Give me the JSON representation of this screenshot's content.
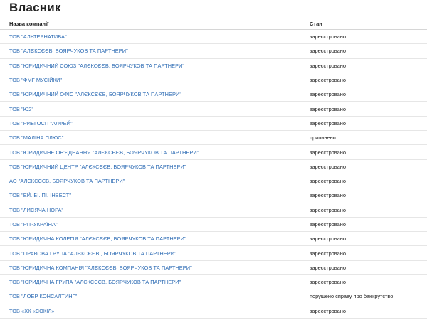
{
  "page": {
    "title": "Власник"
  },
  "table": {
    "headers": {
      "name": "Назва компанії",
      "status": "Стан"
    },
    "rows": [
      {
        "name": "ТОВ \"АЛЬТЕРНАТИВА\"",
        "status": "зареєстровано"
      },
      {
        "name": "ТОВ \"АЛЄКСЄЄВ, БОЯРЧУКОВ ТА ПАРТНЕРИ\"",
        "status": "зареєстровано"
      },
      {
        "name": "ТОВ \"ЮРИДИЧНИЙ СОЮЗ \"АЛЄКСЄЄВ, БОЯРЧУКОВ ТА ПАРТНЕРИ\"",
        "status": "зареєстровано"
      },
      {
        "name": "ТОВ \"ФМГ МУСІЙКИ\"",
        "status": "зареєстровано"
      },
      {
        "name": "ТОВ \"ЮРИДИЧНИЙ ОФІС \"АЛЄКСЄЄВ, БОЯРЧУКОВ ТА ПАРТНЕРИ\"",
        "status": "зареєстровано"
      },
      {
        "name": "ТОВ \"Ю2\"",
        "status": "зареєстровано"
      },
      {
        "name": "ТОВ \"РИБГОСП \"АЛФЕЙ\"",
        "status": "зареєстровано"
      },
      {
        "name": "ТОВ \"МАЛІНА ПЛЮС\"",
        "status": "припинено"
      },
      {
        "name": "ТОВ \"ЮРИДИЧНЕ ОБ'ЄДНАННЯ \"АЛЄКСЄЄВ, БОЯРЧУКОВ ТА ПАРТНЕРИ\"",
        "status": "зареєстровано"
      },
      {
        "name": "ТОВ \"ЮРИДИЧНИЙ ЦЕНТР \"АЛЄКСЄЄВ, БОЯРЧУКОВ ТА ПАРТНЕРИ\"",
        "status": "зареєстровано"
      },
      {
        "name": "АО \"АЛЄКСЄЄВ, БОЯРЧУКОВ ТА ПАРТНЕРИ\"",
        "status": "зареєстровано"
      },
      {
        "name": "ТОВ \"ЕЙ. БІ. ПІ. ІНВЕСТ\"",
        "status": "зареєстровано"
      },
      {
        "name": "ТОВ \"ЛИСЯЧА НОРА\"",
        "status": "зареєстровано"
      },
      {
        "name": "ТОВ \"РІТ-УКРАЇНА\"",
        "status": "зареєстровано"
      },
      {
        "name": "ТОВ \"ЮРИДИЧНА КОЛЕГІЯ \"АЛЄКСЄЄВ, БОЯРЧУКОВ ТА ПАРТНЕРИ\"",
        "status": "зареєстровано"
      },
      {
        "name": "ТОВ \"ПРАВОВА ГРУПА \"АЛЄКСЄЄВ , БОЯРЧУКОВ ТА ПАРТНЕРИ\"",
        "status": "зареєстровано"
      },
      {
        "name": "ТОВ \"ЮРИДИЧНА КОМПАНІЯ \"АЛЄКСЄЄВ, БОЯРЧУКОВ ТА ПАРТНЕРИ\"",
        "status": "зареєстровано"
      },
      {
        "name": "ТОВ \"ЮРИДИЧНА ГРУПА \"АЛЄКСЄЄВ, БОЯРЧУКОВ ТА ПАРТНЕРИ\"",
        "status": "зареєстровано"
      },
      {
        "name": "ТОВ \"ЛОЕР КОНСАЛТИНГ\"",
        "status": "порушено справу про банкрутство"
      },
      {
        "name": "ТОВ «ХК «СОКІЛ»",
        "status": "зареєстровано"
      }
    ]
  },
  "colors": {
    "link": "#2f6db5",
    "text": "#222222"
  }
}
